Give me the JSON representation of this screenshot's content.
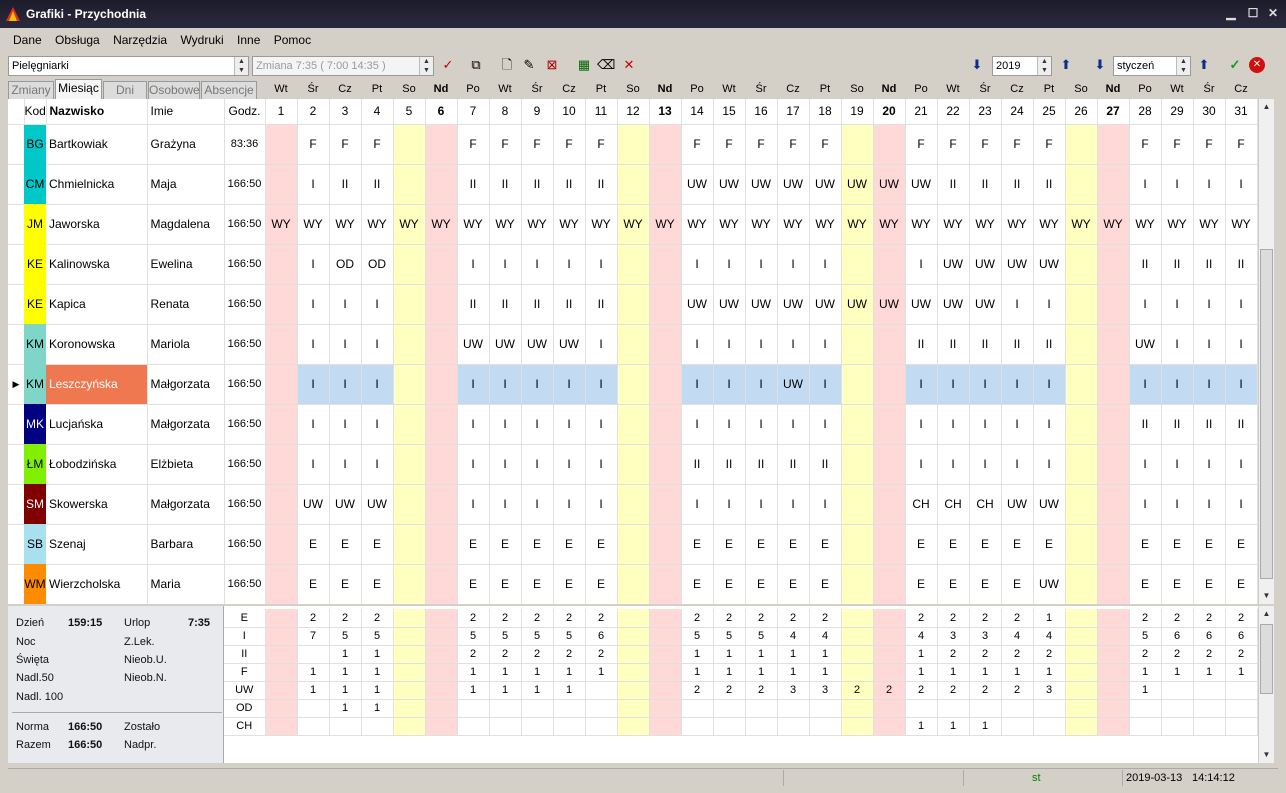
{
  "window": {
    "title": "Grafiki - Przychodnia"
  },
  "menu": [
    "Dane",
    "Obsługa",
    "Narzędzia",
    "Wydruki",
    "Inne",
    "Pomoc"
  ],
  "toolbar": {
    "group": "Pielęgniarki",
    "shift": "Zmiana 7:35 ( 7:00 14:35 )",
    "year": "2019",
    "month": "styczeń"
  },
  "tabs": [
    "Zmiany",
    "Miesiąc",
    "Dni",
    "Osobowe",
    "Absencje"
  ],
  "active_tab": "Miesiąc",
  "grid": {
    "headers": {
      "kod": "Kod",
      "surname": "Nazwisko",
      "name": "Imie",
      "hours": "Godz."
    },
    "days": [
      {
        "num": "1",
        "dow": "Wt",
        "type": "hol"
      },
      {
        "num": "2",
        "dow": "Śr",
        "type": ""
      },
      {
        "num": "3",
        "dow": "Cz",
        "type": ""
      },
      {
        "num": "4",
        "dow": "Pt",
        "type": ""
      },
      {
        "num": "5",
        "dow": "So",
        "type": "sat"
      },
      {
        "num": "6",
        "dow": "Nd",
        "type": "sun"
      },
      {
        "num": "7",
        "dow": "Po",
        "type": ""
      },
      {
        "num": "8",
        "dow": "Wt",
        "type": ""
      },
      {
        "num": "9",
        "dow": "Śr",
        "type": ""
      },
      {
        "num": "10",
        "dow": "Cz",
        "type": ""
      },
      {
        "num": "11",
        "dow": "Pt",
        "type": ""
      },
      {
        "num": "12",
        "dow": "So",
        "type": "sat"
      },
      {
        "num": "13",
        "dow": "Nd",
        "type": "sun"
      },
      {
        "num": "14",
        "dow": "Po",
        "type": ""
      },
      {
        "num": "15",
        "dow": "Wt",
        "type": ""
      },
      {
        "num": "16",
        "dow": "Śr",
        "type": ""
      },
      {
        "num": "17",
        "dow": "Cz",
        "type": ""
      },
      {
        "num": "18",
        "dow": "Pt",
        "type": ""
      },
      {
        "num": "19",
        "dow": "So",
        "type": "sat"
      },
      {
        "num": "20",
        "dow": "Nd",
        "type": "sun"
      },
      {
        "num": "21",
        "dow": "Po",
        "type": ""
      },
      {
        "num": "22",
        "dow": "Wt",
        "type": ""
      },
      {
        "num": "23",
        "dow": "Śr",
        "type": ""
      },
      {
        "num": "24",
        "dow": "Cz",
        "type": ""
      },
      {
        "num": "25",
        "dow": "Pt",
        "type": ""
      },
      {
        "num": "26",
        "dow": "So",
        "type": "sat"
      },
      {
        "num": "27",
        "dow": "Nd",
        "type": "sun"
      },
      {
        "num": "28",
        "dow": "Po",
        "type": ""
      },
      {
        "num": "29",
        "dow": "Wt",
        "type": ""
      },
      {
        "num": "30",
        "dow": "Śr",
        "type": ""
      },
      {
        "num": "31",
        "dow": "Cz",
        "type": ""
      }
    ],
    "rows": [
      {
        "kod": "BG",
        "color": "#00c8c8",
        "kodColor": "#000",
        "surname": "Bartkowiak",
        "name": "Grażyna",
        "hours": "83:36",
        "cells": [
          "",
          "F",
          "F",
          "F",
          "",
          "",
          "F",
          "F",
          "F",
          "F",
          "F",
          "",
          "",
          "F",
          "F",
          "F",
          "F",
          "F",
          "",
          "",
          "F",
          "F",
          "F",
          "F",
          "F",
          "",
          "",
          "F",
          "F",
          "F",
          "F"
        ]
      },
      {
        "kod": "CM",
        "color": "#00c8c8",
        "kodColor": "#000",
        "surname": "Chmielnicka",
        "name": "Maja",
        "hours": "166:50",
        "cells": [
          "",
          "I",
          "II",
          "II",
          "",
          "",
          "II",
          "II",
          "II",
          "II",
          "II",
          "",
          "",
          "UW",
          "UW",
          "UW",
          "UW",
          "UW",
          "UW",
          "UW",
          "UW",
          "II",
          "II",
          "II",
          "II",
          "",
          "",
          "I",
          "I",
          "I",
          "I"
        ]
      },
      {
        "kod": "JM",
        "color": "#ffff00",
        "kodColor": "#000",
        "surname": "Jaworska",
        "name": "Magdalena",
        "hours": "166:50",
        "cells": [
          "WY",
          "WY",
          "WY",
          "WY",
          "WY",
          "WY",
          "WY",
          "WY",
          "WY",
          "WY",
          "WY",
          "WY",
          "WY",
          "WY",
          "WY",
          "WY",
          "WY",
          "WY",
          "WY",
          "WY",
          "WY",
          "WY",
          "WY",
          "WY",
          "WY",
          "WY",
          "WY",
          "WY",
          "WY",
          "WY",
          "WY"
        ]
      },
      {
        "kod": "KE",
        "color": "#ffff00",
        "kodColor": "#000",
        "surname": "Kalinowska",
        "name": "Ewelina",
        "hours": "166:50",
        "cells": [
          "",
          "I",
          "OD",
          "OD",
          "",
          "",
          "I",
          "I",
          "I",
          "I",
          "I",
          "",
          "",
          "I",
          "I",
          "I",
          "I",
          "I",
          "",
          "",
          "I",
          "UW",
          "UW",
          "UW",
          "UW",
          "",
          "",
          "II",
          "II",
          "II",
          "II"
        ]
      },
      {
        "kod": "KE",
        "color": "#ffff00",
        "kodColor": "#000",
        "surname": "Kapica",
        "name": "Renata",
        "hours": "166:50",
        "cells": [
          "",
          "I",
          "I",
          "I",
          "",
          "",
          "II",
          "II",
          "II",
          "II",
          "II",
          "",
          "",
          "UW",
          "UW",
          "UW",
          "UW",
          "UW",
          "UW",
          "UW",
          "UW",
          "UW",
          "UW",
          "I",
          "I",
          "",
          "",
          "I",
          "I",
          "I",
          "I"
        ]
      },
      {
        "kod": "KM",
        "color": "#7fd6c8",
        "kodColor": "#000",
        "surname": "Koronowska",
        "name": "Mariola",
        "hours": "166:50",
        "cells": [
          "",
          "I",
          "I",
          "I",
          "",
          "",
          "UW",
          "UW",
          "UW",
          "UW",
          "I",
          "",
          "",
          "I",
          "I",
          "I",
          "I",
          "I",
          "",
          "",
          "II",
          "II",
          "II",
          "II",
          "II",
          "",
          "",
          "UW",
          "I",
          "I",
          "I"
        ]
      },
      {
        "kod": "KM",
        "color": "#7fd6c8",
        "kodColor": "#000",
        "surname": "Leszczyńska",
        "name": "Małgorzata",
        "hours": "166:50",
        "selected": true,
        "cells": [
          "",
          "I",
          "I",
          "I",
          "",
          "",
          "I",
          "I",
          "I",
          "I",
          "I",
          "",
          "",
          "I",
          "I",
          "I",
          "UW",
          "I",
          "",
          "",
          "I",
          "I",
          "I",
          "I",
          "I",
          "",
          "",
          "I",
          "I",
          "I",
          "I"
        ]
      },
      {
        "kod": "MK",
        "color": "#000080",
        "kodColor": "#fff",
        "surname": "Lucjańska",
        "name": "Małgorzata",
        "hours": "166:50",
        "cells": [
          "",
          "I",
          "I",
          "I",
          "",
          "",
          "I",
          "I",
          "I",
          "I",
          "I",
          "",
          "",
          "I",
          "I",
          "I",
          "I",
          "I",
          "",
          "",
          "I",
          "I",
          "I",
          "I",
          "I",
          "",
          "",
          "II",
          "II",
          "II",
          "II"
        ]
      },
      {
        "kod": "ŁM",
        "color": "#80f000",
        "kodColor": "#000",
        "surname": "Łobodzińska",
        "name": "Elżbieta",
        "hours": "166:50",
        "cells": [
          "",
          "I",
          "I",
          "I",
          "",
          "",
          "I",
          "I",
          "I",
          "I",
          "I",
          "",
          "",
          "II",
          "II",
          "II",
          "II",
          "II",
          "",
          "",
          "I",
          "I",
          "I",
          "I",
          "I",
          "",
          "",
          "I",
          "I",
          "I",
          "I"
        ]
      },
      {
        "kod": "SM",
        "color": "#800000",
        "kodColor": "#fff",
        "surname": "Skowerska",
        "name": "Małgorzata",
        "hours": "166:50",
        "cells": [
          "",
          "UW",
          "UW",
          "UW",
          "",
          "",
          "I",
          "I",
          "I",
          "I",
          "I",
          "",
          "",
          "I",
          "I",
          "I",
          "I",
          "I",
          "",
          "",
          "CH",
          "CH",
          "CH",
          "UW",
          "UW",
          "",
          "",
          "I",
          "I",
          "I",
          "I"
        ]
      },
      {
        "kod": "SB",
        "color": "#a8e0f0",
        "kodColor": "#000",
        "surname": "Szenaj",
        "name": "Barbara",
        "hours": "166:50",
        "cells": [
          "",
          "E",
          "E",
          "E",
          "",
          "",
          "E",
          "E",
          "E",
          "E",
          "E",
          "",
          "",
          "E",
          "E",
          "E",
          "E",
          "E",
          "",
          "",
          "E",
          "E",
          "E",
          "E",
          "E",
          "",
          "",
          "E",
          "E",
          "E",
          "E"
        ]
      },
      {
        "kod": "WM",
        "color": "#ff8c00",
        "kodColor": "#000",
        "surname": "Wierzcholska",
        "name": "Maria",
        "hours": "166:50",
        "cells": [
          "",
          "E",
          "E",
          "E",
          "",
          "",
          "E",
          "E",
          "E",
          "E",
          "E",
          "",
          "",
          "E",
          "E",
          "E",
          "E",
          "E",
          "",
          "",
          "E",
          "E",
          "E",
          "E",
          "UW",
          "",
          "",
          "E",
          "E",
          "E",
          "E"
        ]
      }
    ]
  },
  "summary": {
    "dzien_label": "Dzień",
    "dzien": "159:15",
    "noc_label": "Noc",
    "swieta_label": "Święta",
    "nadl50_label": "Nadl.50",
    "nadl100_label": "Nadl. 100",
    "urlop_label": "Urlop",
    "urlop": "7:35",
    "zlek_label": "Z.Lek.",
    "nieobu_label": "Nieob.U.",
    "nieobn_label": "Nieob.N.",
    "norma_label": "Norma",
    "norma": "166:50",
    "razem_label": "Razem",
    "razem": "166:50",
    "zostalo_label": "Zostało",
    "nadpr_label": "Nadpr."
  },
  "totals": [
    {
      "code": "E",
      "cells": [
        "",
        "2",
        "2",
        "2",
        "",
        "",
        "2",
        "2",
        "2",
        "2",
        "2",
        "",
        "",
        "2",
        "2",
        "2",
        "2",
        "2",
        "",
        "",
        "2",
        "2",
        "2",
        "2",
        "1",
        "",
        "",
        "2",
        "2",
        "2",
        "2"
      ]
    },
    {
      "code": "I",
      "cells": [
        "",
        "7",
        "5",
        "5",
        "",
        "",
        "5",
        "5",
        "5",
        "5",
        "6",
        "",
        "",
        "5",
        "5",
        "5",
        "4",
        "4",
        "",
        "",
        "4",
        "3",
        "3",
        "4",
        "4",
        "",
        "",
        "5",
        "6",
        "6",
        "6"
      ]
    },
    {
      "code": "II",
      "cells": [
        "",
        "",
        "1",
        "1",
        "",
        "",
        "2",
        "2",
        "2",
        "2",
        "2",
        "",
        "",
        "1",
        "1",
        "1",
        "1",
        "1",
        "",
        "",
        "1",
        "2",
        "2",
        "2",
        "2",
        "",
        "",
        "2",
        "2",
        "2",
        "2"
      ]
    },
    {
      "code": "F",
      "cells": [
        "",
        "1",
        "1",
        "1",
        "",
        "",
        "1",
        "1",
        "1",
        "1",
        "1",
        "",
        "",
        "1",
        "1",
        "1",
        "1",
        "1",
        "",
        "",
        "1",
        "1",
        "1",
        "1",
        "1",
        "",
        "",
        "1",
        "1",
        "1",
        "1"
      ]
    },
    {
      "code": "UW",
      "cells": [
        "",
        "1",
        "1",
        "1",
        "",
        "",
        "1",
        "1",
        "1",
        "1",
        "",
        "",
        "",
        "2",
        "2",
        "2",
        "3",
        "3",
        "2",
        "2",
        "2",
        "2",
        "2",
        "2",
        "3",
        "",
        "",
        "1",
        "",
        "",
        ""
      ]
    },
    {
      "code": "OD",
      "cells": [
        "",
        "",
        "1",
        "1",
        "",
        "",
        "",
        "",
        "",
        "",
        "",
        "",
        "",
        "",
        "",
        "",
        "",
        "",
        "",
        "",
        "",
        "",
        "",
        "",
        "",
        "",
        "",
        "",
        "",
        "",
        ""
      ]
    },
    {
      "code": "CH",
      "cells": [
        "",
        "",
        "",
        "",
        "",
        "",
        "",
        "",
        "",
        "",
        "",
        "",
        "",
        "",
        "",
        "",
        "",
        "",
        "",
        "",
        "1",
        "1",
        "1",
        "",
        "",
        "",
        "",
        "",
        "",
        "",
        ""
      ]
    }
  ],
  "status": {
    "text": "st",
    "datetime": "2019-03-13",
    "time": "14:14:12"
  },
  "colors": {
    "saturday": "#ffffc0",
    "sunday": "#ffd8d8",
    "selected": "#c2daf2",
    "selected_name": "#f07850"
  }
}
